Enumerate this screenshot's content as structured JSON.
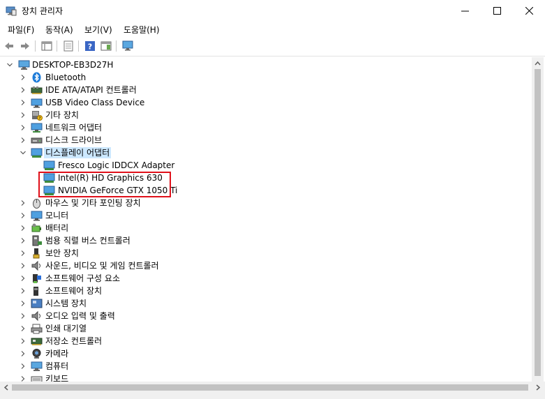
{
  "window": {
    "title": "장치 관리자"
  },
  "menu": [
    {
      "label": "파일(F)"
    },
    {
      "label": "동작(A)"
    },
    {
      "label": "보기(V)"
    },
    {
      "label": "도움말(H)"
    }
  ],
  "toolbar": [
    "back-icon",
    "forward-icon",
    "show-hide-tree-icon",
    "properties-icon",
    "help-icon",
    "action-pane-icon",
    "monitor-scan-icon"
  ],
  "tree": {
    "root": "DESKTOP-EB3D27H",
    "items": [
      {
        "label": "Bluetooth",
        "icon": "bluetooth-icon",
        "expanded": false
      },
      {
        "label": "IDE ATA/ATAPI 컨트롤러",
        "icon": "ide-controller-icon",
        "expanded": false
      },
      {
        "label": "USB Video Class Device",
        "icon": "usb-video-icon",
        "expanded": false
      },
      {
        "label": "기타 장치",
        "icon": "other-devices-icon",
        "expanded": false
      },
      {
        "label": "네트워크 어댑터",
        "icon": "network-adapter-icon",
        "expanded": false
      },
      {
        "label": "디스크 드라이브",
        "icon": "disk-drive-icon",
        "expanded": false
      },
      {
        "label": "디스플레이 어댑터",
        "icon": "display-adapter-icon",
        "expanded": true,
        "selected": true,
        "children": [
          {
            "label": "Fresco Logic IDDCX Adapter"
          },
          {
            "label": "Intel(R) HD Graphics 630"
          },
          {
            "label": "NVIDIA GeForce GTX 1050 Ti"
          }
        ]
      },
      {
        "label": "마우스 및 기타 포인팅 장치",
        "icon": "mouse-icon",
        "expanded": false
      },
      {
        "label": "모니터",
        "icon": "monitor-icon",
        "expanded": false
      },
      {
        "label": "배터리",
        "icon": "battery-icon",
        "expanded": false
      },
      {
        "label": "범용 직렬 버스 컨트롤러",
        "icon": "usb-controller-icon",
        "expanded": false
      },
      {
        "label": "보안 장치",
        "icon": "security-device-icon",
        "expanded": false
      },
      {
        "label": "사운드, 비디오 및 게임 컨트롤러",
        "icon": "sound-icon",
        "expanded": false
      },
      {
        "label": "소프트웨어 구성 요소",
        "icon": "software-component-icon",
        "expanded": false
      },
      {
        "label": "소프트웨어 장치",
        "icon": "software-device-icon",
        "expanded": false
      },
      {
        "label": "시스템 장치",
        "icon": "system-device-icon",
        "expanded": false
      },
      {
        "label": "오디오 입력 및 출력",
        "icon": "audio-io-icon",
        "expanded": false
      },
      {
        "label": "인쇄 대기열",
        "icon": "print-queue-icon",
        "expanded": false
      },
      {
        "label": "저장소 컨트롤러",
        "icon": "storage-controller-icon",
        "expanded": false
      },
      {
        "label": "카메라",
        "icon": "camera-icon",
        "expanded": false
      },
      {
        "label": "컴퓨터",
        "icon": "computer-icon",
        "expanded": false
      },
      {
        "label": "키보드",
        "icon": "keyboard-icon",
        "expanded": false
      }
    ]
  },
  "colors": {
    "selection": "#cce8ff",
    "highlight_box": "#e0101a"
  }
}
